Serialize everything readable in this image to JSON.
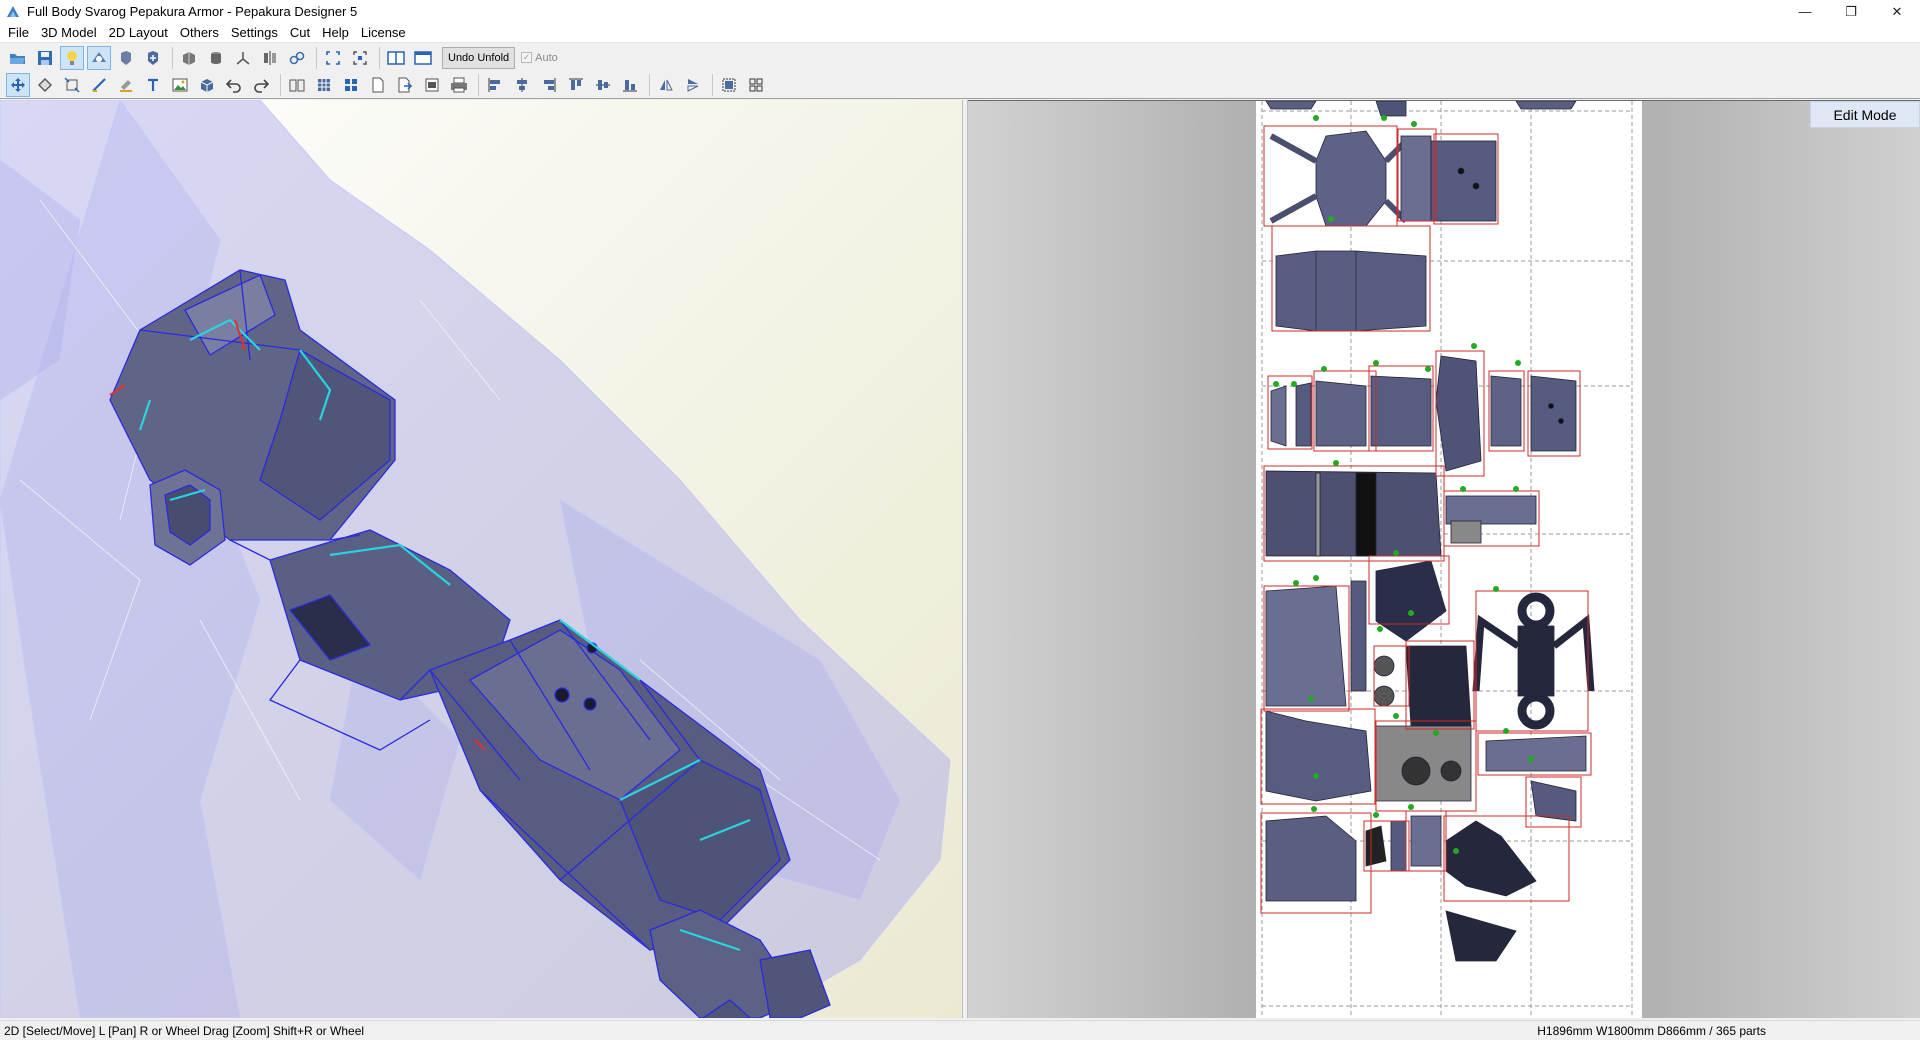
{
  "window": {
    "title": "Full Body Svarog Pepakura Armor - Pepakura Designer 5",
    "minimize": "—",
    "restore": "❐",
    "close": "✕"
  },
  "menu": [
    "File",
    "3D Model",
    "2D Layout",
    "Others",
    "Settings",
    "Cut",
    "Help",
    "License"
  ],
  "toolbar1": {
    "icons": [
      "open-icon",
      "save-icon",
      "light-bulb-icon",
      "unfold-mode-icon",
      "rotate-icon",
      "pan-3d-icon",
      "texture-icon",
      "cylinder-icon",
      "axis-icon",
      "mirror-icon",
      "link-icon",
      "fit-icon",
      "zoom-extent-icon",
      "split-view-icon",
      "single-view-icon"
    ],
    "undo_unfold_label": "Undo Unfold",
    "auto_label": "Auto"
  },
  "toolbar2": {
    "icons": [
      "select-move-icon",
      "join-icon",
      "scale-icon",
      "line-icon",
      "paint-icon",
      "text-icon",
      "image-icon",
      "box-icon",
      "undo-icon",
      "redo-icon",
      "book-icon",
      "grid-icon",
      "layout-icon",
      "page-icon",
      "export-icon",
      "print-preview-icon",
      "print-icon",
      "align-left-icon",
      "align-center-icon",
      "align-right-icon",
      "align-top-icon",
      "align-middle-icon",
      "align-bottom-icon",
      "flip-h-icon",
      "flip-v-icon",
      "group-icon",
      "arrange-icon"
    ]
  },
  "view2d": {
    "mode_label": "Edit Mode"
  },
  "status": {
    "left": "2D [Select/Move] L [Pan] R or Wheel Drag [Zoom] Shift+R or Wheel",
    "right": "H1896mm W1800mm D866mm / 365 parts"
  },
  "colors": {
    "mesh_edge": "#2a2ae0",
    "mesh_fill": "#5a5f80",
    "ghost_body": "#a8a8ec",
    "seam": "#29d3e0",
    "part_outline": "#cc2a2a",
    "flap_pin": "#22aa22"
  }
}
